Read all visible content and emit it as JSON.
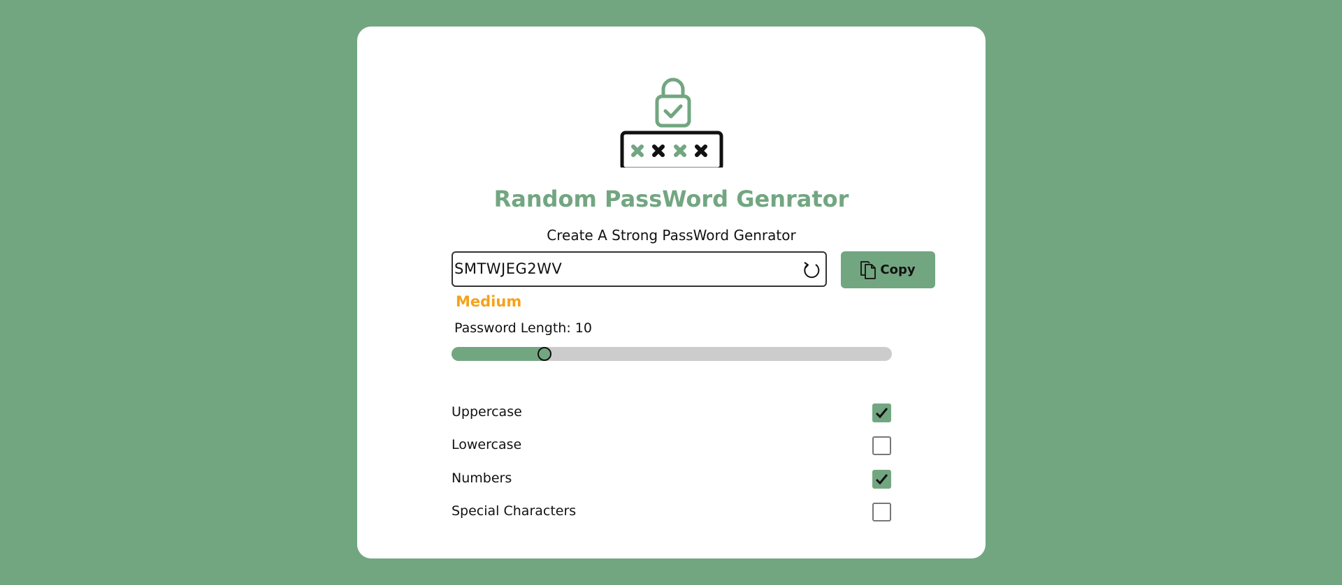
{
  "colors": {
    "background": "#72a681",
    "accent": "#72a681",
    "strength": "#f5a21a",
    "card": "#ffffff"
  },
  "header": {
    "logo_icon": "lock-password-icon",
    "title": "Random PassWord Genrator",
    "subtitle": "Create A Strong PassWord Genrator"
  },
  "password": {
    "value": "SMTWJEG2WV",
    "refresh_icon": "refresh-icon"
  },
  "copy_button": {
    "label": "Copy",
    "icon": "copy-icon"
  },
  "strength": "Medium",
  "length": {
    "label": "Password Length: 10",
    "value": 10,
    "min": 6,
    "max": 25
  },
  "options": [
    {
      "label": "Uppercase",
      "checked": true
    },
    {
      "label": "Lowercase",
      "checked": false
    },
    {
      "label": "Numbers",
      "checked": true
    },
    {
      "label": "Special Characters",
      "checked": false
    }
  ]
}
